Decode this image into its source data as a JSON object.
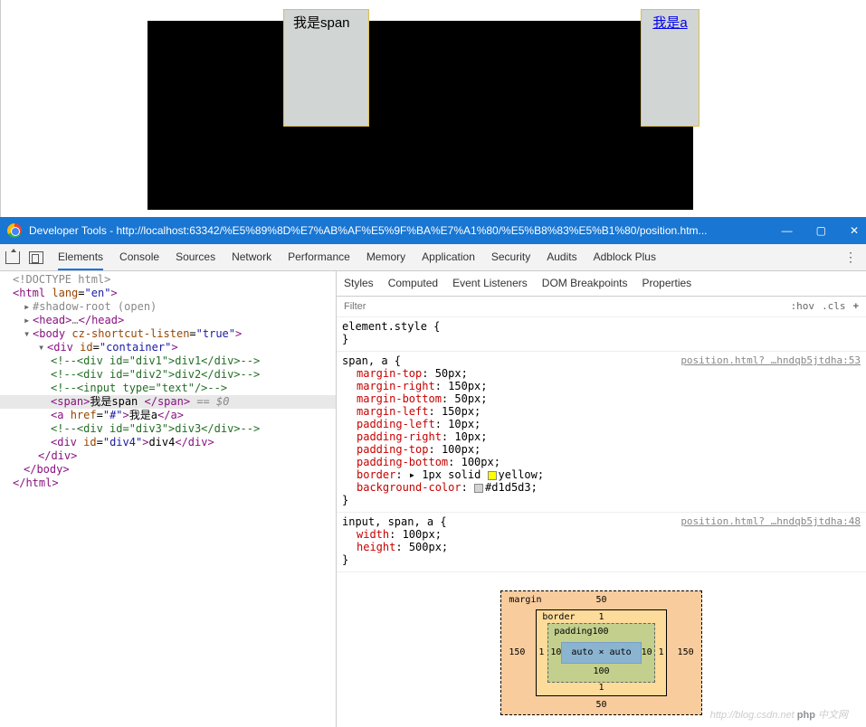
{
  "preview": {
    "span_text": "我是span",
    "a_text": "我是a"
  },
  "titlebar": {
    "text": "Developer Tools - http://localhost:63342/%E5%89%8D%E7%AB%AF%E5%9F%BA%E7%A1%80/%E5%B8%83%E5%B1%80/position.htm...",
    "minimize": "—",
    "maximize": "▢",
    "close": "✕"
  },
  "tabs": {
    "items": [
      "Elements",
      "Console",
      "Sources",
      "Network",
      "Performance",
      "Memory",
      "Application",
      "Security",
      "Audits",
      "Adblock Plus"
    ],
    "active": 0
  },
  "dom": {
    "doctype": "<!DOCTYPE html>",
    "html_open": "html",
    "lang_attr": "lang",
    "lang_val": "\"en\"",
    "shadow": "#shadow-root (open)",
    "head": "head",
    "head_ell": "…",
    "body": "body",
    "body_attr": "cz-shortcut-listen",
    "body_val": "\"true\"",
    "container": "div",
    "container_id_attr": "id",
    "container_id_val": "\"container\"",
    "c1": "<!--<div id=\"div1\">div1</div>-->",
    "c2": "<!--<div id=\"div2\">div2</div>-->",
    "c3": "<!--<input type=\"text\"/>-->",
    "span_tag": "span",
    "span_txt": "我是span ",
    "eq0": "== $0",
    "a_tag": "a",
    "a_href_attr": "href",
    "a_href_val": "\"#\"",
    "a_txt": "我是a",
    "c4": "<!--<div id=\"div3\">div3</div>-->",
    "div4_tag": "div",
    "div4_id_attr": "id",
    "div4_id_val": "\"div4\"",
    "div4_txt": "div4"
  },
  "styletabs": [
    "Styles",
    "Computed",
    "Event Listeners",
    "DOM Breakpoints",
    "Properties"
  ],
  "filter": {
    "placeholder": "Filter",
    "hov": ":hov",
    "cls": ".cls",
    "plus": "+"
  },
  "rules": {
    "r0": {
      "sel": "element.style {",
      "close": "}"
    },
    "r1": {
      "sel": "span, a {",
      "src": "position.html? …hndqb5jtdha:53",
      "props": [
        {
          "n": "margin-top",
          "v": "50px;"
        },
        {
          "n": "margin-right",
          "v": "150px;"
        },
        {
          "n": "margin-bottom",
          "v": "50px;"
        },
        {
          "n": "margin-left",
          "v": "150px;"
        },
        {
          "n": "padding-left",
          "v": "10px;"
        },
        {
          "n": "padding-right",
          "v": "10px;"
        },
        {
          "n": "padding-top",
          "v": "100px;"
        },
        {
          "n": "padding-bottom",
          "v": "100px;"
        },
        {
          "n": "border",
          "v": "1px solid",
          "swatch": "yellow",
          "after": "yellow;",
          "tri": true
        },
        {
          "n": "background-color",
          "v": "",
          "swatch": "gray",
          "after": "#d1d5d3;"
        }
      ],
      "close": "}"
    },
    "r2": {
      "sel": "input, span, a {",
      "src": "position.html? …hndqb5jtdha:48",
      "props": [
        {
          "n": "width",
          "v": "100px;"
        },
        {
          "n": "height",
          "v": "500px;"
        }
      ],
      "close": "}"
    }
  },
  "boxmodel": {
    "margin_label": "margin",
    "margin": {
      "t": "50",
      "r": "150",
      "b": "50",
      "l": "150"
    },
    "border_label": "border",
    "border": {
      "t": "1",
      "r": "1",
      "b": "1",
      "l": "1"
    },
    "padding_label": "padding100",
    "padding": {
      "t": "",
      "r": "10",
      "b": "100",
      "l": "10"
    },
    "content": "auto × auto",
    "pad_top": "100",
    "pad_l": "10"
  },
  "watermark": {
    "blog": "http://blog.csdn.net",
    "php": "php",
    "cn": "中文网"
  }
}
